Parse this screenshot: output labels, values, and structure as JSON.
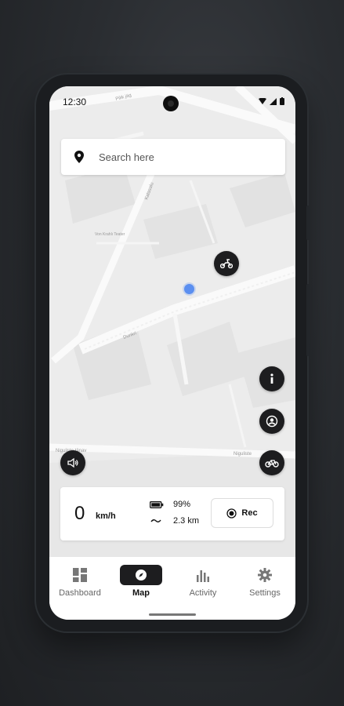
{
  "status_bar": {
    "time": "12:30"
  },
  "search": {
    "placeholder": "Search here"
  },
  "map_labels": {
    "street_1": "Pilik jäg",
    "street_2": "Kalasalu",
    "street_3": "Von Krahlı Teater",
    "street_4": "Dunkri",
    "street_5": "Niguliste",
    "street_6": "Niguliste tänav"
  },
  "info_card": {
    "speed": "0",
    "speed_unit": "km/h",
    "battery": "99%",
    "distance": "2.3 km",
    "rec_label": "Rec"
  },
  "nav": {
    "items": [
      {
        "label": "Dashboard",
        "icon": "dashboard-icon"
      },
      {
        "label": "Map",
        "icon": "compass-icon",
        "active": true
      },
      {
        "label": "Activity",
        "icon": "bar-chart-icon"
      },
      {
        "label": "Settings",
        "icon": "gear-icon"
      }
    ]
  },
  "colors": {
    "location_dot": "#5b8ff0",
    "fab": "#1d1d1f",
    "map_bg": "#ececec"
  }
}
